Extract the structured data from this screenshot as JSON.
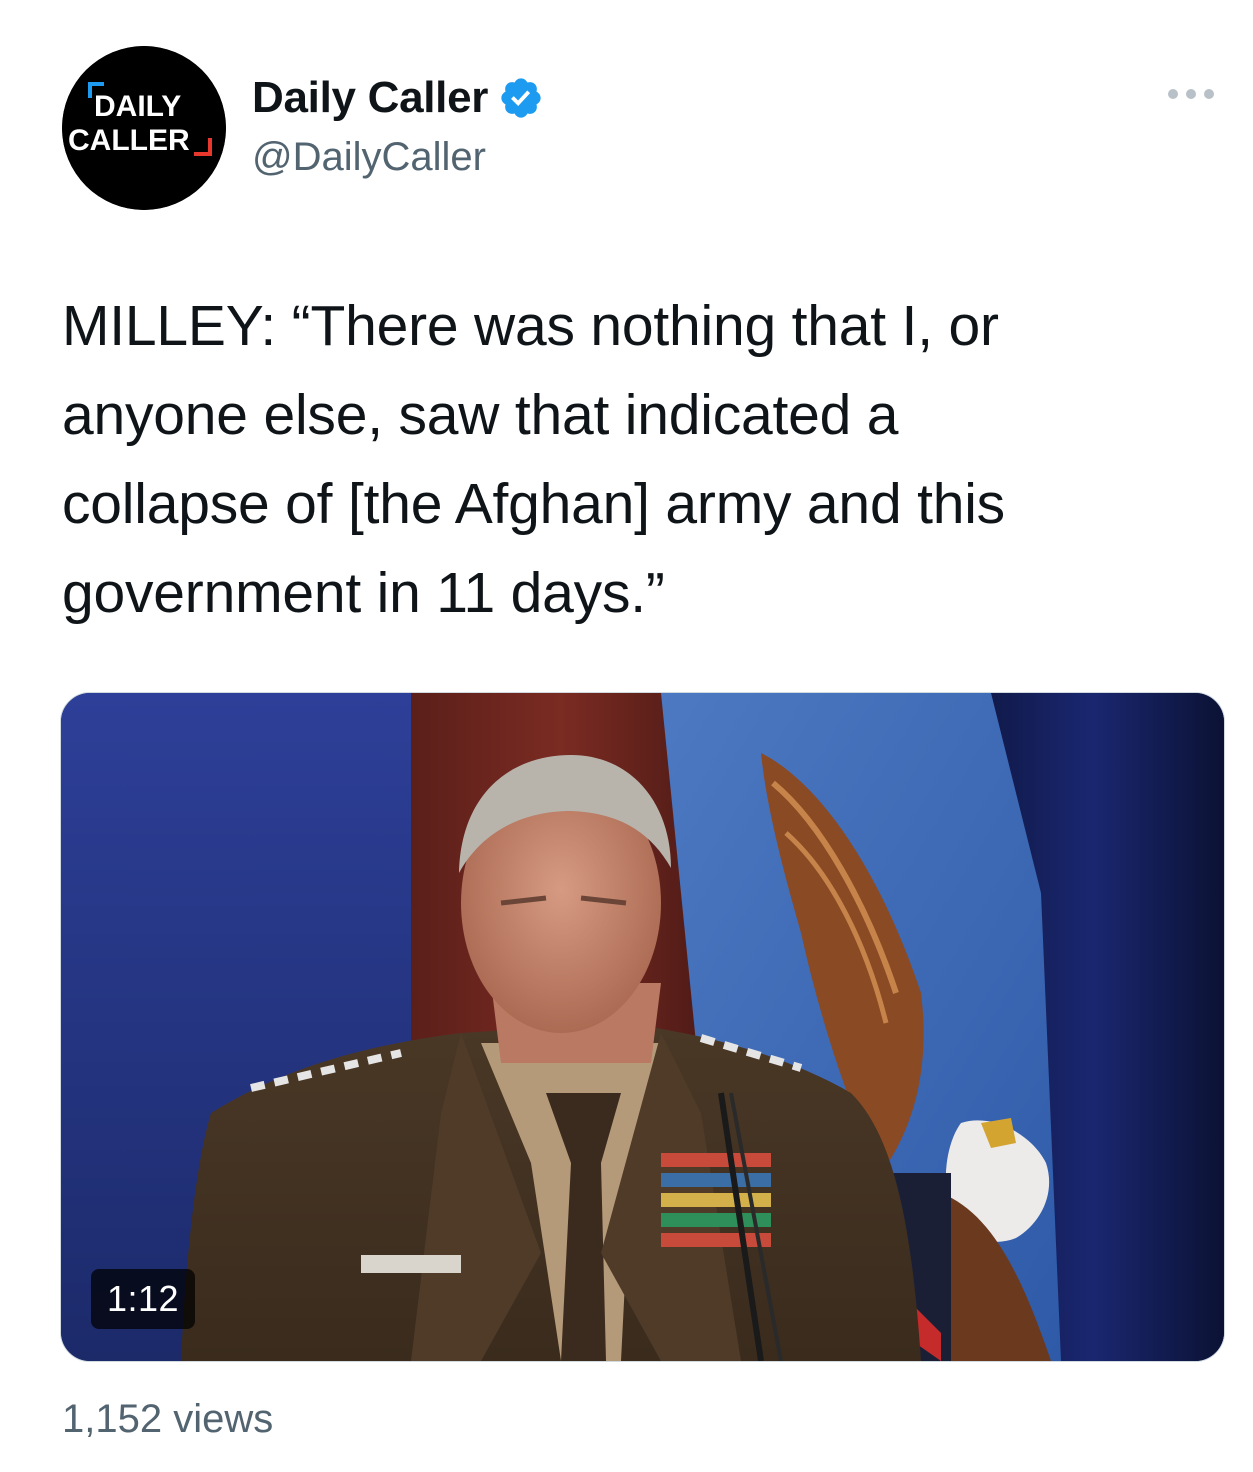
{
  "author": {
    "display_name": "Daily Caller",
    "handle": "@DailyCaller",
    "verified": true,
    "avatar_line1": "DAILY",
    "avatar_line2": "CALLER"
  },
  "tweet": {
    "lines": [
      "MILLEY: “There was nothing that I, or",
      "anyone else, saw that indicated a",
      "collapse of [the Afghan] army and this",
      "government in 11 days.”"
    ]
  },
  "media": {
    "type": "video",
    "duration": "1:12"
  },
  "stats": {
    "views": "1,152 views"
  },
  "icons": {
    "verified": "verified-badge-icon",
    "more": "more-options-icon"
  },
  "colors": {
    "verified_blue": "#1d9bf0",
    "secondary_text": "#536471",
    "primary_text": "#0f1419",
    "logo_red": "#e8372c"
  }
}
